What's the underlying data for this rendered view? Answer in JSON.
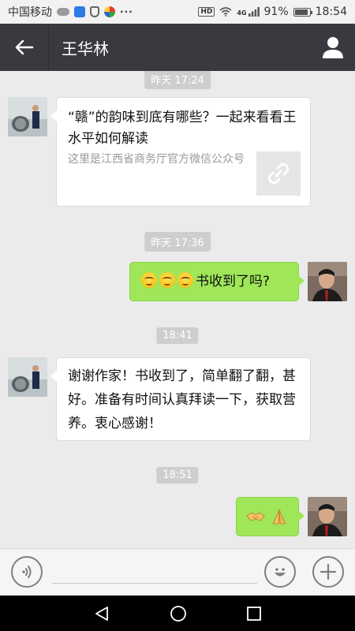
{
  "status_bar": {
    "carrier": "中国移动",
    "network": "4G",
    "battery_text": "91%",
    "battery_level": 0.91,
    "time": "18:54",
    "hd_badge": "HD",
    "more": "···"
  },
  "header": {
    "title": "王华林",
    "back_icon": "back-arrow-icon",
    "profile_icon": "profile-person-icon",
    "bg_color": "#393a3f"
  },
  "messages": {
    "time1": "昨天 17:24",
    "time2": "昨天 17:36",
    "time3": "18:41",
    "time4": "18:51",
    "link_card": {
      "title": "“赣”的韵味到底有哪些？一起来看看王水平如何解读",
      "description": "这里是江西省商务厅官方微信公众号",
      "thumb_icon": "link-icon"
    },
    "out1_text": "书收到了吗?",
    "out1_emojis": [
      "smile-emoji",
      "smile-emoji",
      "smile-emoji"
    ],
    "in2_text": "谢谢作家！书收到了，简单翻了翻，甚好。准备有时间认真拜读一下，获取营养。衷心感谢！",
    "out2_emojis": [
      "handshake-emoji",
      "pray-emoji"
    ]
  },
  "input_bar": {
    "voice_icon": "voice-icon",
    "emoji_icon": "emoji-icon",
    "plus_icon": "plus-icon",
    "placeholder": ""
  },
  "nav_bar": {
    "back_icon": "triangle-back-icon",
    "home_icon": "circle-home-icon",
    "recents_icon": "square-recents-icon"
  },
  "colors": {
    "out_bubble": "#9fe658",
    "in_bubble": "#ffffff",
    "chat_bg": "#ebebeb"
  }
}
